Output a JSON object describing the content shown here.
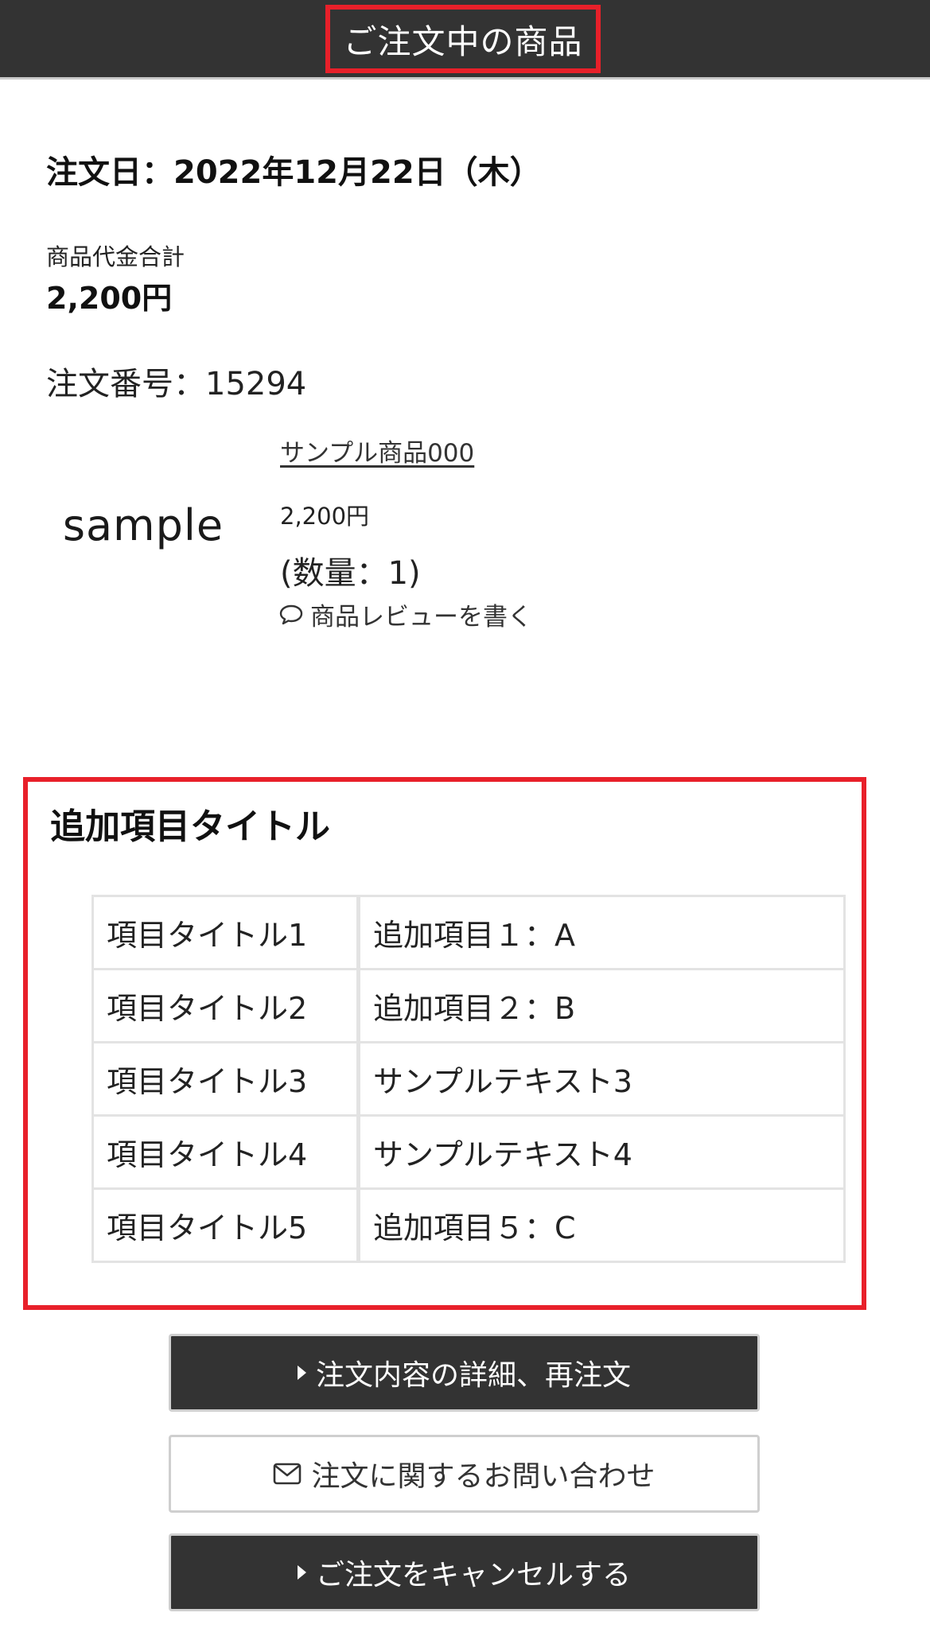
{
  "header": {
    "title": "ご注文中の商品"
  },
  "order": {
    "date": "注文日：2022年12月22日（木）",
    "subtotal_label": "商品代金合計",
    "subtotal_value": "2,200円",
    "number": "注文番号：15294"
  },
  "product": {
    "image_text": "sample",
    "name": "サンプル商品000",
    "price": "2,200円",
    "quantity": "(数量：1)",
    "review_link": "商品レビューを書く",
    "review_icon": "speech-bubble-icon"
  },
  "additional": {
    "title": "追加項目タイトル",
    "rows": [
      {
        "label": "項目タイトル1",
        "value": "追加項目１：A"
      },
      {
        "label": "項目タイトル2",
        "value": "追加項目２：B"
      },
      {
        "label": "項目タイトル3",
        "value": "サンプルテキスト3"
      },
      {
        "label": "項目タイトル4",
        "value": "サンプルテキスト4"
      },
      {
        "label": "項目タイトル5",
        "value": "追加項目５：C"
      }
    ]
  },
  "buttons": {
    "detail": "注文内容の詳細、再注文",
    "contact": "注文に関するお問い合わせ",
    "cancel": "ご注文をキャンセルする",
    "detail_icon": "triangle-right-icon",
    "contact_icon": "envelope-icon",
    "cancel_icon": "triangle-right-icon"
  },
  "colors": {
    "header_bg": "#333333",
    "highlight": "#e8202a",
    "button_dark": "#333333"
  }
}
